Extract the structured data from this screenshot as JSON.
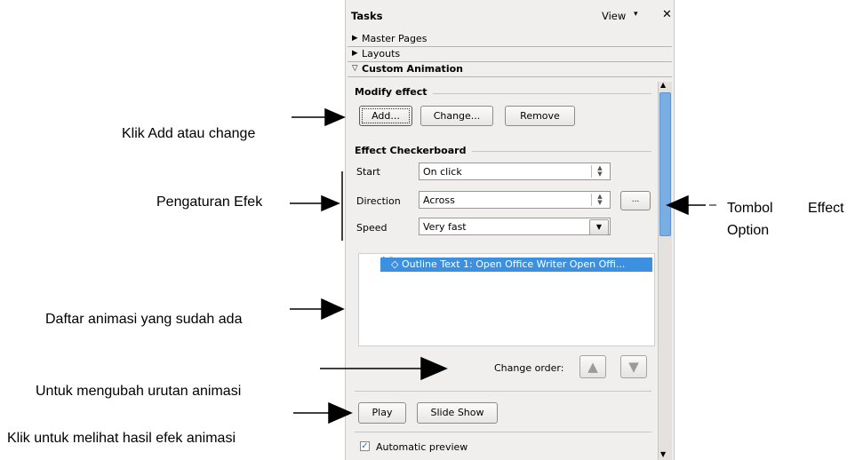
{
  "annotations": {
    "add_change": "Klik Add atau change",
    "settings": "Pengaturan Efek",
    "list": "Daftar animasi yang sudah ada",
    "order": "Untuk mengubah urutan animasi",
    "play": "Klik untuk melihat hasil efek animasi",
    "option_1": "Tombol",
    "option_2": "Effect",
    "option_3": "Option"
  },
  "panel": {
    "title": "Tasks",
    "view_label": "View",
    "view_arrow": "▾",
    "close": "✕",
    "sections": [
      {
        "label": "Master Pages",
        "icon": "▶"
      },
      {
        "label": "Layouts",
        "icon": "▶"
      },
      {
        "label": "Custom Animation",
        "icon": "▽"
      }
    ]
  },
  "modify": {
    "header": "Modify effect",
    "add": "Add...",
    "change": "Change...",
    "remove": "Remove"
  },
  "effect": {
    "header": "Effect Checkerboard",
    "start_label": "Start",
    "start_value": "On click",
    "direction_label": "Direction",
    "direction_value": "Across",
    "speed_label": "Speed",
    "speed_value": "Very fast",
    "options_btn": "..."
  },
  "list": {
    "item": "Outline Text 1: Open Office Writer Open Offi..."
  },
  "order": {
    "label": "Change order:",
    "up": "▲",
    "down": "▼"
  },
  "play": {
    "play": "Play",
    "slideshow": "Slide Show"
  },
  "preview": {
    "label": "Automatic preview",
    "checked": true
  },
  "colors": {
    "selection": "#3d8fe0",
    "scroll_thumb": "#7aaee3",
    "panel_bg": "#f0efed"
  }
}
